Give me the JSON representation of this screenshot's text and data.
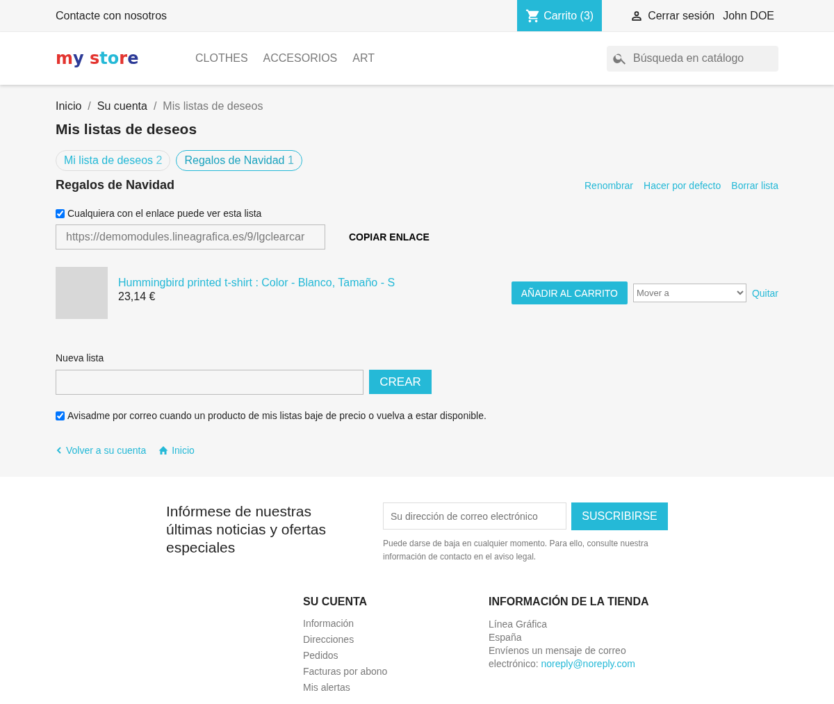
{
  "top_bar": {
    "contact": "Contacte con nosotros",
    "cart": "Carrito (3)",
    "logout": "Cerrar sesión",
    "user": "John DOE"
  },
  "header": {
    "logo": "my store",
    "menu": [
      "CLOTHES",
      "ACCESORIOS",
      "ART"
    ],
    "search": {
      "placeholder": "Búsqueda en catálogo"
    }
  },
  "breadcrumb": [
    {
      "label": "Inicio",
      "current": false
    },
    {
      "label": "Su cuenta",
      "current": false
    },
    {
      "label": "Mis listas de deseos",
      "current": true
    }
  ],
  "breadcrumb_separator": "/",
  "page_title": "Mis listas de deseos",
  "tabs": [
    {
      "label": "Mi lista de deseos",
      "count": "2",
      "selected": false
    },
    {
      "label": "Regalos de Navidad",
      "count": "1",
      "selected": true
    }
  ],
  "list": {
    "title": "Regalos de Navidad",
    "actions": [
      "Renombrar",
      "Hacer por defecto",
      "Borrar lista"
    ],
    "share": {
      "label": "Cualquiera con el enlace puede ver esta lista",
      "checked": true,
      "url": "https://demomodules.lineagrafica.es/9/lgclearcar",
      "copy": "COPIAR ENLACE"
    },
    "products": [
      {
        "name": "Hummingbird printed t-shirt : Color - Blanco, Tamaño - S",
        "price": "23,14 €",
        "add": "AÑADIR AL CARRITO",
        "move": "Mover a",
        "remove": "Quitar"
      }
    ]
  },
  "new_list": {
    "label": "Nueva lista",
    "button": "CREAR",
    "notify": {
      "label": "Avisadme por correo cuando un producto de mis listas baje de precio o vuelva a estar disponible.",
      "checked": true
    }
  },
  "links": [
    "Volver a su cuenta",
    "Inicio"
  ],
  "newsletter": {
    "title": "Infórmese de nuestras últimas noticias y ofertas especiales",
    "placeholder": "Su dirección de correo electrónico",
    "button": "SUSCRIBIRSE",
    "note": "Puede darse de baja en cualquier momento. Para ello, consulte nuestra información de contacto en el aviso legal."
  },
  "footer": {
    "account": {
      "title": "SU CUENTA",
      "items": [
        "Información",
        "Direcciones",
        "Pedidos",
        "Facturas por abono",
        "Mis alertas"
      ]
    },
    "store": {
      "title": "INFORMACIÓN DE LA TIENDA",
      "lines": [
        "Línea Gráfica",
        "España",
        "Envíenos un mensaje de correo"
      ],
      "email_prefix": "electrónico:",
      "email": "noreply@noreply.com"
    }
  }
}
